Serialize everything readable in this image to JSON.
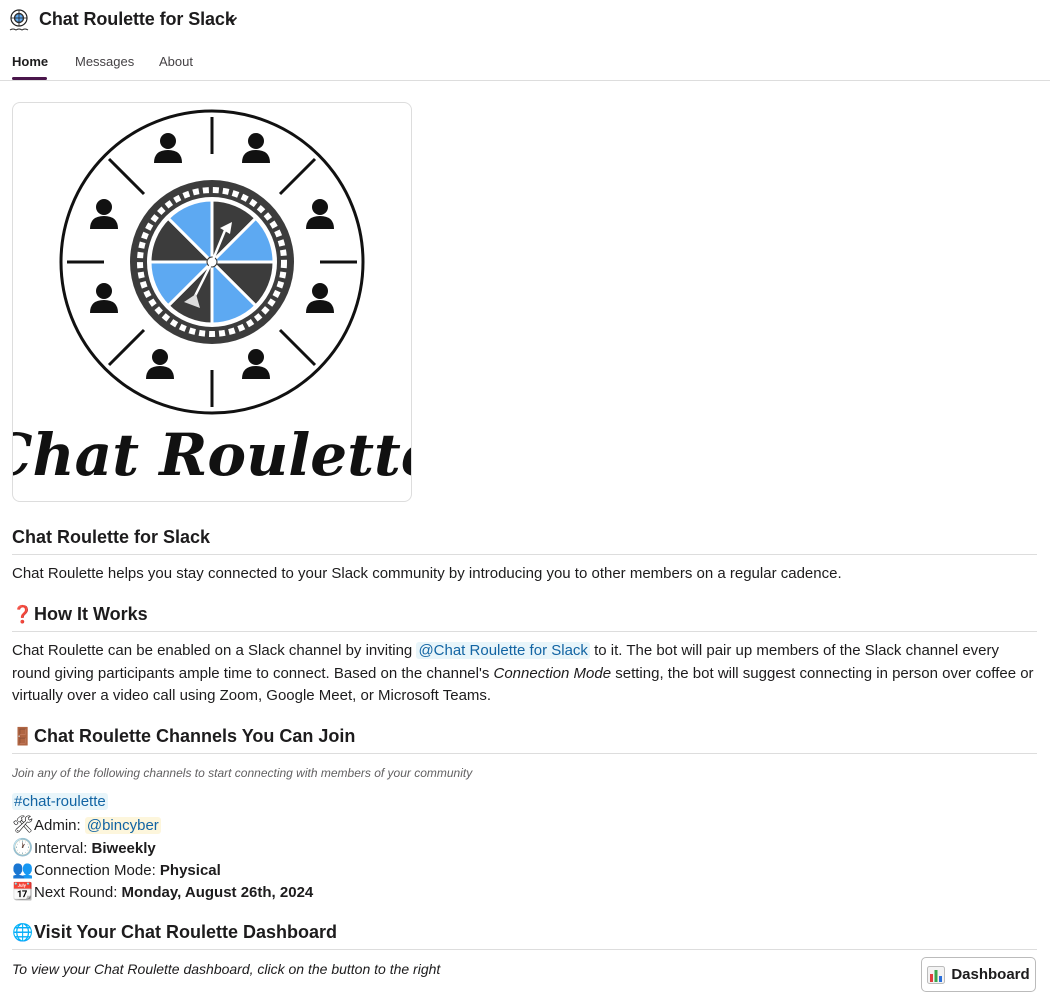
{
  "header": {
    "app_title": "Chat Roulette for Slack",
    "app_icon": "roulette-logo-icon",
    "chevron": "chevron-down-icon"
  },
  "tabs": [
    {
      "label": "Home",
      "active": true
    },
    {
      "label": "Messages",
      "active": false
    },
    {
      "label": "About",
      "active": false
    }
  ],
  "hero": {
    "logo_text": "Chat Roulette",
    "wheel_colors": {
      "blue": "#5da9f2",
      "dark": "#3c3c3c"
    }
  },
  "intro": {
    "heading": "Chat Roulette for Slack",
    "text": "Chat Roulette helps you stay connected to your Slack community by introducing you to other members on a regular cadence."
  },
  "how_it_works": {
    "icon": "question-icon",
    "heading": "How It Works",
    "text_1": "Chat Roulette can be enabled on a Slack channel by inviting ",
    "mention": "@Chat Roulette for Slack",
    "text_2": " to it. The bot will pair up members of the Slack channel every round giving participants ample time to connect. Based on the channel's ",
    "emphasis": "Connection Mode",
    "text_3": " setting, the bot will suggest connecting in person over coffee or virtually over a video call using Zoom, Google Meet, or Microsoft Teams."
  },
  "channels": {
    "icon": "door-icon",
    "heading": "Chat Roulette Channels You Can Join",
    "subtitle": "Join any of the following channels to start connecting with members of your community",
    "channel": "#chat-roulette",
    "admin_label": "Admin: ",
    "admin_value": "@bincyber",
    "interval_label": "Interval: ",
    "interval_value": "Biweekly",
    "mode_label": "Connection Mode: ",
    "mode_value": "Physical",
    "next_label": "Next Round: ",
    "next_value": "Monday, August 26th, 2024"
  },
  "dashboard": {
    "icon": "globe-icon",
    "heading": "Visit Your Chat Roulette Dashboard",
    "text": "To view your Chat Roulette dashboard, click on the button to the right",
    "button_label": "Dashboard",
    "button_icon": "bar-chart-icon"
  }
}
